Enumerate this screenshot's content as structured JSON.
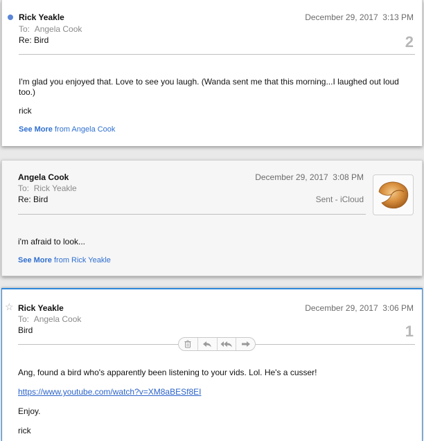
{
  "messages": [
    {
      "from": "Rick Yeakle",
      "to_label": "To:",
      "to": "Angela Cook",
      "subject": "Re: Bird",
      "date": "December 29, 2017",
      "time": "3:13 PM",
      "count": "2",
      "body": [
        "I'm glad you enjoyed that. Love to see you laugh. (Wanda sent me that this morning...I laughed out loud too.)",
        "rick"
      ],
      "see_more_label": "See More",
      "see_more_from": "from Angela Cook"
    },
    {
      "from": "Angela Cook",
      "to_label": "To:",
      "to": "Rick Yeakle",
      "subject": "Re: Bird",
      "date": "December 29, 2017",
      "time": "3:08 PM",
      "mailbox": "Sent - iCloud",
      "body": [
        "i'm afraid to look..."
      ],
      "see_more_label": "See More",
      "see_more_from": "from Rick Yeakle"
    },
    {
      "from": "Rick Yeakle",
      "to_label": "To:",
      "to": "Angela Cook",
      "subject": "Bird",
      "date": "December 29, 2017",
      "time": "3:06 PM",
      "count": "1",
      "body": [
        "Ang, found a bird who's apparently been listening to your vids. Lol. He's a cusser!",
        "Enjoy.",
        "rick"
      ],
      "link": "https://www.youtube.com/watch?v=XM8aBESf8EI"
    }
  ],
  "icons": {
    "unread": "unread-dot-icon",
    "flag": "star-icon",
    "trash": "trash-icon",
    "reply": "reply-icon",
    "reply_all": "reply-all-icon",
    "forward": "forward-icon"
  },
  "colors": {
    "accent": "#2d86d9",
    "link": "#2c63c9",
    "unread_dot": "#5b85d6"
  }
}
